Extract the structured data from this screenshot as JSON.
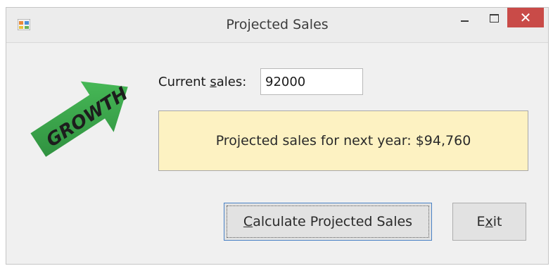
{
  "window": {
    "title": "Projected Sales",
    "close_glyph": "✕"
  },
  "form": {
    "current_sales_label_pre": "Current ",
    "current_sales_label_mnemonic": "s",
    "current_sales_label_post": "ales:",
    "current_sales_value": "92000",
    "result_text": "Projected sales for next year: $94,760"
  },
  "image": {
    "text": "GROWTH"
  },
  "buttons": {
    "calculate_mnemonic": "C",
    "calculate_rest": "alculate Projected Sales",
    "exit_pre": "E",
    "exit_mnemonic": "x",
    "exit_post": "it"
  },
  "colors": {
    "close_button": "#c94b48",
    "result_background": "#fdf2c2",
    "focus_border": "#4a82c6",
    "arrow_green": "#3aa84a"
  },
  "icons": {
    "app": "app-icon",
    "minimize": "minimize-icon",
    "maximize": "maximize-icon",
    "close": "close-icon",
    "growth": "growth-arrow-icon"
  }
}
